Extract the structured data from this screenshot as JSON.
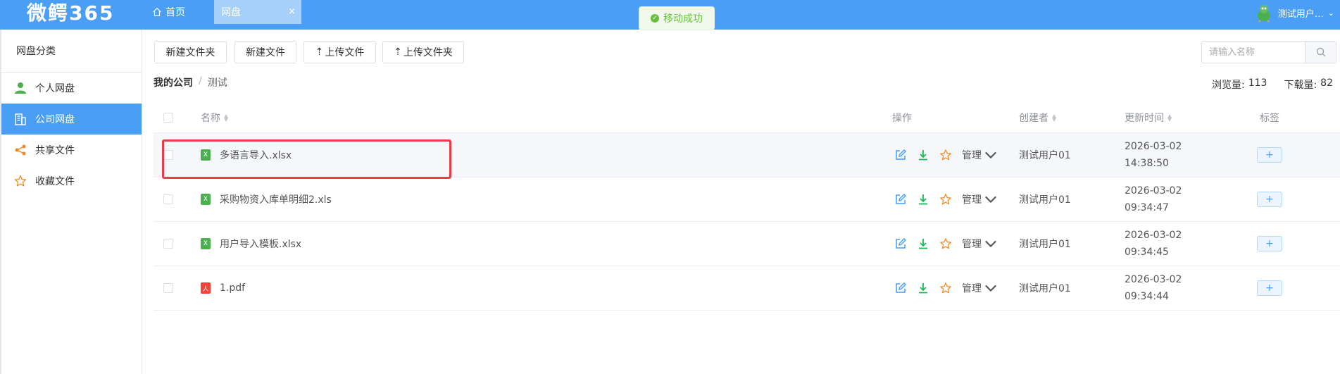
{
  "app": {
    "logo": "微鳄365",
    "home_label": "首页",
    "tab_label": "网盘",
    "tab_close": "×",
    "toast": "移动成功",
    "user_name": "测试用户…"
  },
  "sidebar": {
    "title": "网盘分类",
    "items": [
      {
        "label": "个人网盘",
        "icon": "person-icon",
        "active": false
      },
      {
        "label": "公司网盘",
        "icon": "building-icon",
        "active": true
      },
      {
        "label": "共享文件",
        "icon": "share-icon",
        "active": false
      },
      {
        "label": "收藏文件",
        "icon": "star-icon",
        "active": false
      }
    ]
  },
  "toolbar": {
    "new_folder": "新建文件夹",
    "new_file": "新建文件",
    "upload_file": "上传文件",
    "upload_folder": "上传文件夹",
    "search_placeholder": "请输入名称"
  },
  "breadcrumb": {
    "root": "我的公司",
    "sep": "/",
    "current": "测试"
  },
  "stats": {
    "views_label": "浏览量:",
    "views": "113",
    "downloads_label": "下载量:",
    "downloads": "82"
  },
  "table": {
    "headers": {
      "name": "名称",
      "ops": "操作",
      "creator": "创建者",
      "updated": "更新时间",
      "tags": "标签"
    },
    "manage_label": "管理",
    "tag_add": "+",
    "rows": [
      {
        "name": "多语言导入.xlsx",
        "type": "xls",
        "type_glyph": "X",
        "creator": "测试用户01",
        "date": "2026-03-02",
        "time": "14:38:50"
      },
      {
        "name": "采购物资入库单明细2.xls",
        "type": "xls",
        "type_glyph": "X",
        "creator": "测试用户01",
        "date": "2026-03-02",
        "time": "09:34:47"
      },
      {
        "name": "用户导入模板.xlsx",
        "type": "xls",
        "type_glyph": "X",
        "creator": "测试用户01",
        "date": "2026-03-02",
        "time": "09:34:45"
      },
      {
        "name": "1.pdf",
        "type": "pdf",
        "type_glyph": "人",
        "creator": "测试用户01",
        "date": "2026-03-02",
        "time": "09:34:44"
      }
    ]
  },
  "colors": {
    "primary": "#4a9ff5",
    "highlight_box": "#e5404a",
    "success": "#67c23a"
  }
}
